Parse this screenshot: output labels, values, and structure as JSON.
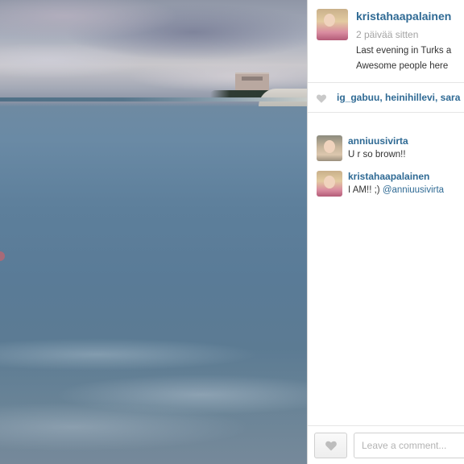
{
  "photo": {
    "description_icon": "beach-photo"
  },
  "post": {
    "username": "kristahaapalainen",
    "time": "2 päivää sitten",
    "caption_lines": [
      "Last evening in Turks a",
      "Awesome people here"
    ]
  },
  "likes": {
    "icon": "heart-icon",
    "text": "ig_gabuu, heinihillevi, sara"
  },
  "comments": [
    {
      "username": "anniuusivirta",
      "text": "U r so brown!!"
    },
    {
      "username": "kristahaapalainen",
      "text": "I AM!! ;)",
      "mention": "@anniuusivirta"
    }
  ],
  "footer": {
    "like_icon": "heart-icon",
    "comment_placeholder": "Leave a comment..."
  },
  "colors": {
    "link": "#2f6a94",
    "muted": "#a3a3a3",
    "border": "#e5e5e5"
  }
}
